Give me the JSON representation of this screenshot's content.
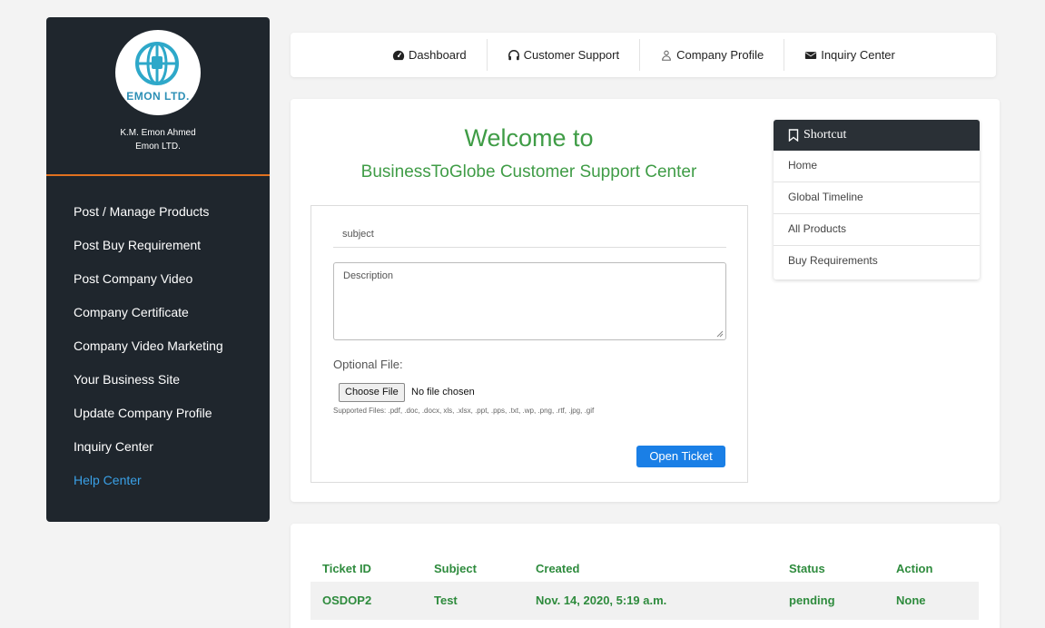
{
  "sidebar": {
    "logo_text": "EMON LTD.",
    "owner_name": "K.M. Emon Ahmed",
    "company_name": "Emon LTD.",
    "items": [
      {
        "label": "Post / Manage Products"
      },
      {
        "label": "Post Buy Requirement"
      },
      {
        "label": "Post Company Video"
      },
      {
        "label": "Company Certificate"
      },
      {
        "label": "Company Video Marketing"
      },
      {
        "label": "Your Business Site"
      },
      {
        "label": "Update Company Profile"
      },
      {
        "label": "Inquiry Center"
      },
      {
        "label": "Help Center"
      }
    ]
  },
  "topnav": {
    "items": [
      {
        "label": "Dashboard",
        "icon": "dashboard-icon"
      },
      {
        "label": "Customer Support",
        "icon": "headphones-icon"
      },
      {
        "label": "Company Profile",
        "icon": "user-icon"
      },
      {
        "label": "Inquiry Center",
        "icon": "envelope-icon"
      }
    ]
  },
  "main": {
    "welcome": "Welcome to",
    "subtitle": "BusinessToGlobe Customer Support Center",
    "form": {
      "subject_placeholder": "subject",
      "description_placeholder": "Description",
      "optional_file_label": "Optional File:",
      "choose_file_label": "Choose File",
      "no_file_text": "No file chosen",
      "supported_files": "Supported Files: .pdf, .doc, .docx, xls, .xlsx, .ppt, .pps, .txt, .wp, .png, .rtf, .jpg, .gif",
      "submit_label": "Open Ticket"
    }
  },
  "shortcut": {
    "title": "Shortcut",
    "items": [
      {
        "label": "Home"
      },
      {
        "label": "Global Timeline"
      },
      {
        "label": "All Products"
      },
      {
        "label": "Buy Requirements"
      }
    ]
  },
  "tickets": {
    "headers": [
      "Ticket ID",
      "Subject",
      "Created",
      "Status",
      "Action"
    ],
    "rows": [
      [
        "OSDOP2",
        "Test",
        "Nov. 14, 2020, 5:19 a.m.",
        "pending",
        "None"
      ]
    ]
  },
  "colors": {
    "sidebar_bg": "#1f262d",
    "accent_green": "#3f9c46",
    "primary_blue": "#1a7fe6",
    "divider_orange": "#e0711f",
    "active_link": "#3aa0e6"
  }
}
